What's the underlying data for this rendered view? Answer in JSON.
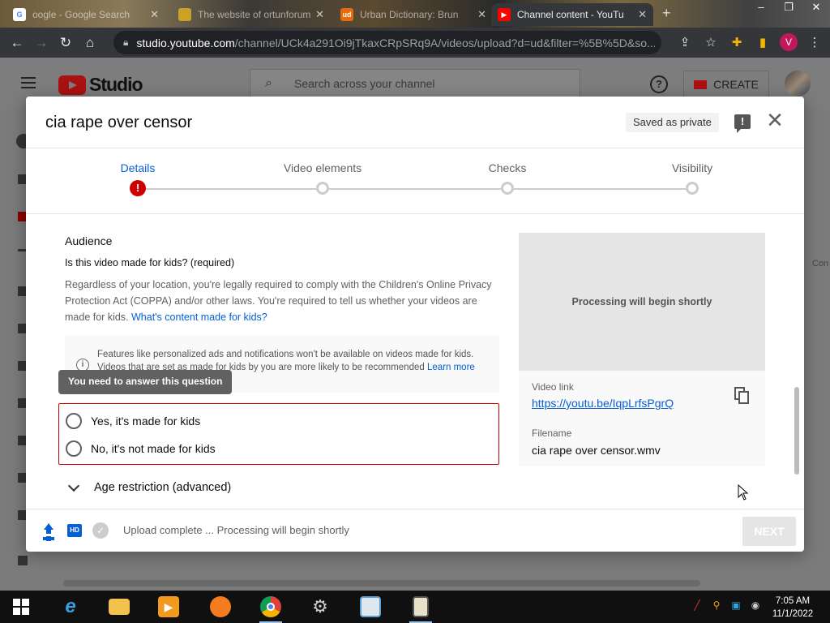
{
  "browser": {
    "tabs": [
      {
        "title": "oogle - Google Search",
        "favicon": "google-icon"
      },
      {
        "title": "The website of ortunforum",
        "favicon": "site-icon"
      },
      {
        "title": "Urban Dictionary: Brun",
        "favicon": "ud-icon"
      },
      {
        "title": "Channel content - YouTu",
        "favicon": "youtube-icon",
        "active": true
      }
    ],
    "url_domain": "studio.youtube.com",
    "url_path": "/channel/UCk4a291Oi9jTkaxCRpSRq9A/videos/upload?d=ud&filter=%5B%5D&so...",
    "profile_initial": "V"
  },
  "studio": {
    "logo_text": "Studio",
    "search_placeholder": "Search across your channel",
    "create_label": "CREATE",
    "help_glyph": "?",
    "right_edge_text": "Con"
  },
  "dialog": {
    "title": "cia rape over censor",
    "saved_badge": "Saved as private",
    "steps": [
      {
        "label": "Details",
        "state": "error"
      },
      {
        "label": "Video elements",
        "state": "pending"
      },
      {
        "label": "Checks",
        "state": "pending"
      },
      {
        "label": "Visibility",
        "state": "pending"
      }
    ],
    "audience": {
      "title": "Audience",
      "question": "Is this video made for kids? (required)",
      "description": "Regardless of your location, you're legally required to comply with the Children's Online Privacy Protection Act (COPPA) and/or other laws. You're required to tell us whether your videos are made for kids.",
      "description_link": "What's content made for kids?",
      "info_text": "Features like personalized ads and notifications won't be available on videos made for kids. Videos that are set as made for kids by you are more likely to be recommended",
      "info_link": "Learn more",
      "tooltip": "You need to answer this question",
      "options": [
        "Yes, it's made for kids",
        "No, it's not made for kids"
      ]
    },
    "age_restriction_label": "Age restriction (advanced)",
    "preview_text": "Processing will begin shortly",
    "video_link_label": "Video link",
    "video_link": "https://youtu.be/IqpLrfsPgrQ",
    "filename_label": "Filename",
    "filename": "cia rape over censor.wmv",
    "footer_status": "Upload complete ... Processing will begin shortly",
    "next_label": "NEXT",
    "hd_badge": "HD"
  },
  "taskbar": {
    "time": "7:05 AM",
    "date": "11/1/2022"
  },
  "colors": {
    "accent_blue": "#065fd4",
    "error_red": "#cc0000",
    "chrome_dark": "#35363a"
  }
}
